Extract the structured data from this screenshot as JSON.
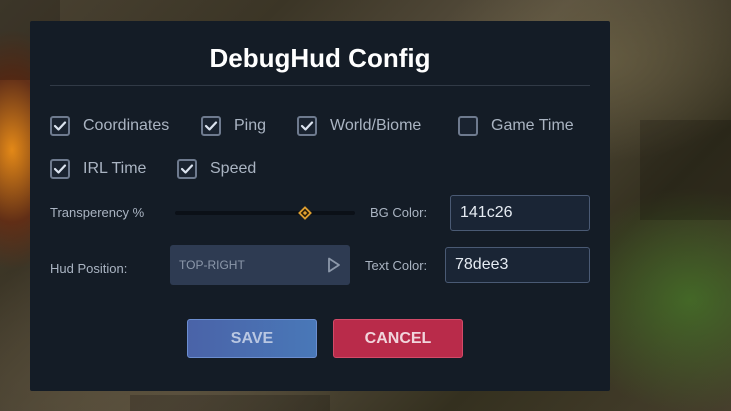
{
  "dialog": {
    "title": "DebugHud Config"
  },
  "options": [
    {
      "label": "Coordinates",
      "checked": true
    },
    {
      "label": "Ping",
      "checked": true
    },
    {
      "label": "World/Biome",
      "checked": true
    },
    {
      "label": "Game Time",
      "checked": false
    },
    {
      "label": "IRL Time",
      "checked": true
    },
    {
      "label": "Speed",
      "checked": true
    }
  ],
  "transparency": {
    "label": "Transperency %",
    "value_fraction": 0.72
  },
  "bg_color": {
    "label": "BG Color:",
    "value": "141c26"
  },
  "hud_position": {
    "label": "Hud Position:",
    "value": "TOP-RIGHT"
  },
  "text_color": {
    "label": "Text Color:",
    "value": "78dee3"
  },
  "buttons": {
    "save": "SAVE",
    "cancel": "CANCEL"
  },
  "colors": {
    "panel": "#141c26",
    "accent": "#e0a030",
    "save": "#4a6bb0",
    "cancel": "#b92b4a"
  },
  "icons": {
    "checkbox_checked": "check-icon",
    "slider_thumb": "diamond-icon",
    "dropdown": "play-triangle-icon"
  }
}
